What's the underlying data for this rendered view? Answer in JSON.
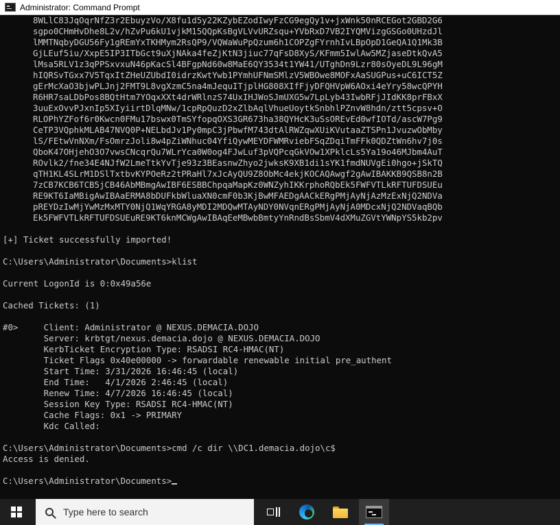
{
  "window": {
    "title": "Administrator: Command Prompt",
    "icon": "cmd-icon"
  },
  "console": {
    "b64_lines": [
      "8WLlC83JqOqrNfZ3r2EbuyzVo/X8fu1d5y22KZybEZodIwyFzCG9egQy1v+jxWnk50nRCEGot2GBD2G6",
      "sgpo0CHmHvDhe8L2v/hZvPu6kU1vjkM15QQpKsBgVLVvURZsqu+YVbRxD7VB2IYQMVizgGSGo0UHzdJl",
      "lMMTNqbyDGU56Fy1gREmYxTKHMym2RsQP9/VQWaWuPpQzum6h1COPZgFYrnhIvLBpOpD1GeQA1Q1Mk3B",
      "GjLEuf5iu/XxpE5IP3ITbGct9uXjNAka4feZjKtN3jiuc77qFsD8XyS/KFmm5IwlAw5MZjaseDtkQvA5",
      "lMsa5RLV1z3qPPSxvxuN46pKacSl4BFgpNd60w8MaE6QY3534t1YW41/UTghDn9Lzr80sOyeDL9L96gM",
      "hIQRSvTGxx7V5TqxItZHeUZUbdI0idrzKwtYwb1PYmhUFNmSMlzV5WBOwe8MOFxAaSUGPus+uC6ICT5Z",
      "gErMcXaO3bjwPLJnj2FMT9L8vgXzmC5na4mJequITjplHG808XIfFjyDFQHVpW6AOxi4eYry58wcQPYH",
      "R6HR7saLDbPos8BQtHtm7YOqxXXt4drWRlnzS74UxIHJWoSJmUXG5w7LpLyb43IwbRFjJIdKK8prFBxX",
      "3uuExOvvPJxnIp5XIyiirtDlqMNw/1cpRpQuzD2xZlbAqlVhueUoytkSnbhlPZnvW8hdn/ztt5cpsv+O",
      "RLOPhYZFof6r0Kwcn0FMu17bswx0TmSYfopqOXS3GR673ha38QYHcK3uSsOREvEd0wfIOTd/ascW7Pg9",
      "CeTP3VQphkMLAB47NVQ0P+NELbdJv1Py0mpC3jPbwfM743dtAlRWZqwXUiKVutaaZTSPn1JvuzwObMby",
      "lS/FEtwVnNXm/FsOmrzJoli8w4pZiWNhuc04YfiQywMEYDFWMRviebFSqZDqiTmFFk0QDZtWn6hv7j0s",
      "QboK47OHjehO3O7vwsCNcqrQu7WLrYca0W0og4FJwLuf3pVQPcqGkVOw1XPklcLs5Ya19o46MJbm4AuT",
      "ROvlk2/fne34E4NJfW2LmeTtkYvTje93z3BEasnwZhyo2jwksK9XB1di1sYK1fmdNUVgEi0hgo+jSkTQ",
      "qTH1KL4SLrM1DSlTxtbvKYPOeRz2tPRaHl7xJcAyQU9Z8ObMc4ekjKOCAQAwgf2gAwIBAKKB9QSB8n2B",
      "7zCB7KCB6TCB5jCB46AbMBmgAwIBF6ESBBChpqaMapKz0WNZyhIKKrphoRQbEk5FWFVTLkRFTUFDSUEu",
      "RE9KT6IaMBigAwIBAaERMA8bDUFkbWluaXN0cmF0b3KjBwMFAEDgAACkERgPMjAyNjAzMzExNjQ2NDVa",
      "pREYDzIwMjYwMzMxMTY0NjQ1WqYRGA8yMDI2MDQwMTAyNDY0NVqnERgPMjAyNjA0MDcxNjQ2NDVaqBQb",
      "Ek5FWFVTLkRFTUFDSUEuRE9KT6knMCWgAwIBAqEeMBwbBmtyYnRndBsSbmV4dXMuZGVtYWNpYS5kb2pv"
    ],
    "import_status": "[+] Ticket successfully imported!",
    "cmd_klist": "C:\\Users\\Administrator\\Documents>klist",
    "logon_id": "Current LogonId is 0:0x49a56e",
    "cached_tickets": "Cached Tickets: (1)",
    "ticket_lines": [
      "#0>     Client: Administrator @ NEXUS.DEMACIA.DOJO",
      "        Server: krbtgt/nexus.demacia.dojo @ NEXUS.DEMACIA.DOJO",
      "        KerbTicket Encryption Type: RSADSI RC4-HMAC(NT)",
      "        Ticket Flags 0x40e00000 -> forwardable renewable initial pre_authent",
      "        Start Time: 3/31/2026 16:46:45 (local)",
      "        End Time:   4/1/2026 2:46:45 (local)",
      "        Renew Time: 4/7/2026 16:46:45 (local)",
      "        Session Key Type: RSADSI RC4-HMAC(NT)",
      "        Cache Flags: 0x1 -> PRIMARY",
      "        Kdc Called:"
    ],
    "cmd_dir": "C:\\Users\\Administrator\\Documents>cmd /c dir \\\\DC1.demacia.dojo\\c$",
    "dir_result": "Access is denied.",
    "prompt": "C:\\Users\\Administrator\\Documents>"
  },
  "taskbar": {
    "search_placeholder": "Type here to search",
    "icons": [
      "windows-start-icon",
      "search-icon",
      "task-view-icon",
      "edge-icon",
      "file-explorer-icon",
      "cmd-icon"
    ]
  }
}
